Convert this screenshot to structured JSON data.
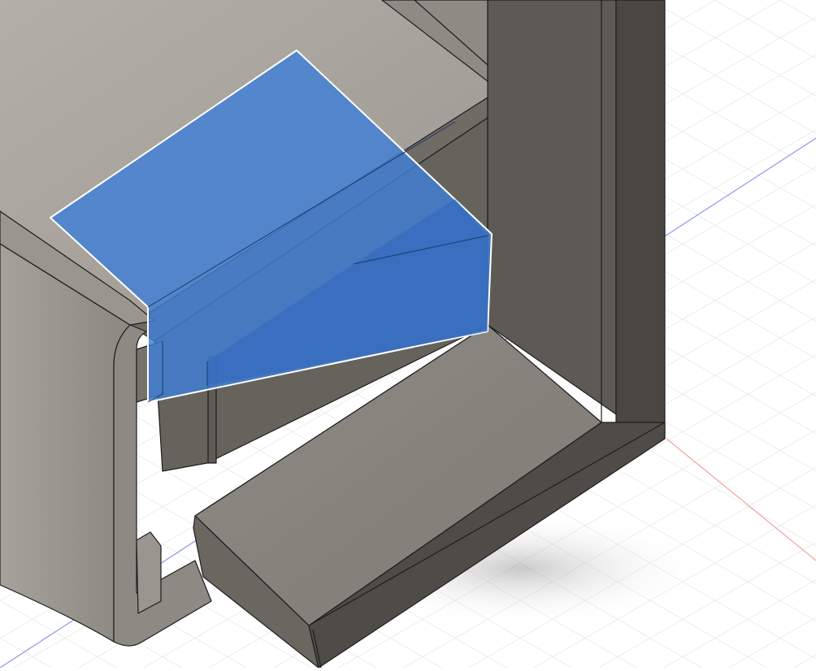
{
  "viewport": {
    "background": "#ffffff",
    "grid_color": "#dcdcdc",
    "axis_x_color": "#f2a39a",
    "axis_y_color": "#8f96ee",
    "model_colors": {
      "light_face": "#a9a49d",
      "mid_face": "#8a857f",
      "dark_face": "#5d5a55",
      "darkest_face": "#4a4743",
      "edge": "#1e1d1b"
    },
    "selection": {
      "fill": "#3f7fd6",
      "outline": "#ffffff"
    }
  }
}
